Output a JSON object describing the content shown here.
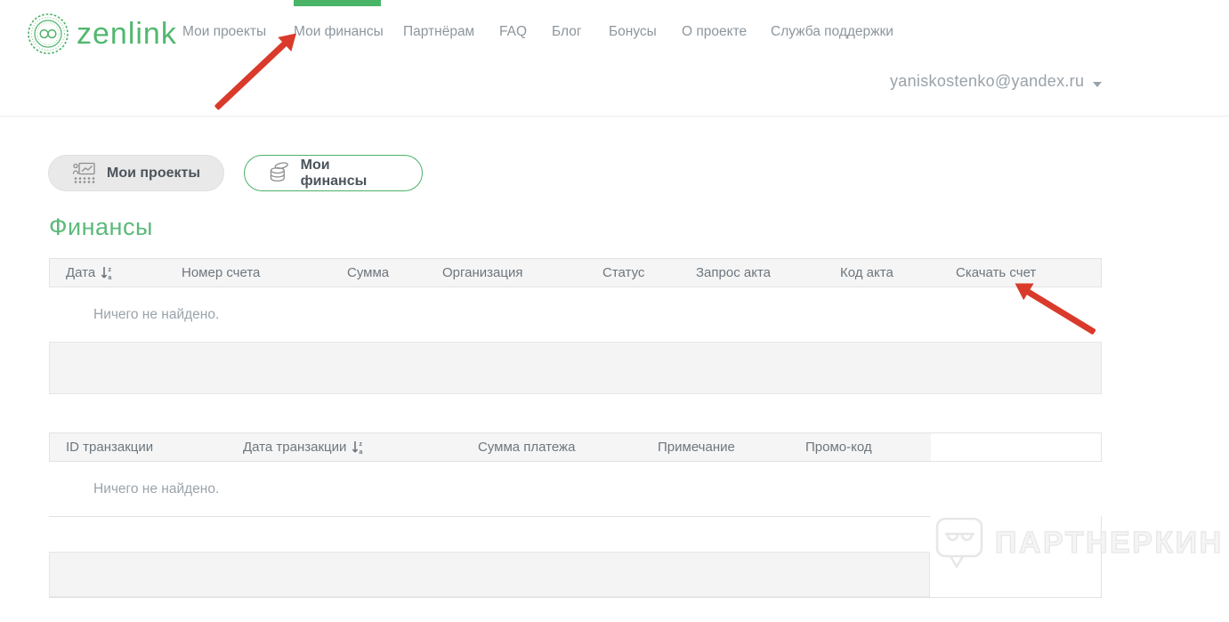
{
  "brand": {
    "name": "zenlink"
  },
  "colors": {
    "green": "#4cb168",
    "red": "#d93a2b",
    "header_gray": "#f5f5f5"
  },
  "nav": {
    "items": [
      {
        "label": "Мои проекты",
        "active": false
      },
      {
        "label": "Мои финансы",
        "active": true
      },
      {
        "label": "Партнёрам",
        "active": false
      },
      {
        "label": "FAQ",
        "active": false
      },
      {
        "label": "Блог",
        "active": false
      },
      {
        "label": "Бонусы",
        "active": false
      },
      {
        "label": "О проекте",
        "active": false
      },
      {
        "label": "Служба поддержки",
        "active": false
      }
    ]
  },
  "account": {
    "email": "yaniskostenko@yandex.ru"
  },
  "tabs": {
    "projects": {
      "label": "Мои проекты",
      "icon": "presentation-icon",
      "selected": false
    },
    "finances": {
      "label": "Мои финансы",
      "icon": "coins-icon",
      "selected": true
    }
  },
  "page": {
    "title": "Финансы"
  },
  "invoices_table": {
    "columns": [
      "Дата",
      "Номер счета",
      "Сумма",
      "Организация",
      "Статус",
      "Запрос акта",
      "Код акта",
      "Скачать счет"
    ],
    "sort_column": "Дата",
    "sort_icon": "sort-desc-za",
    "empty_text": "Ничего не найдено."
  },
  "transactions_table": {
    "columns": [
      "ID транзакции",
      "Дата транзакции",
      "Сумма платежа",
      "Примечание",
      "Промо-код"
    ],
    "sort_column": "Дата транзакции",
    "sort_icon": "sort-desc-za",
    "empty_text": "Ничего не найдено."
  },
  "watermark": {
    "text": "ПАРТНЕРКИН",
    "icon": "partnerkin-bubble-icon"
  }
}
